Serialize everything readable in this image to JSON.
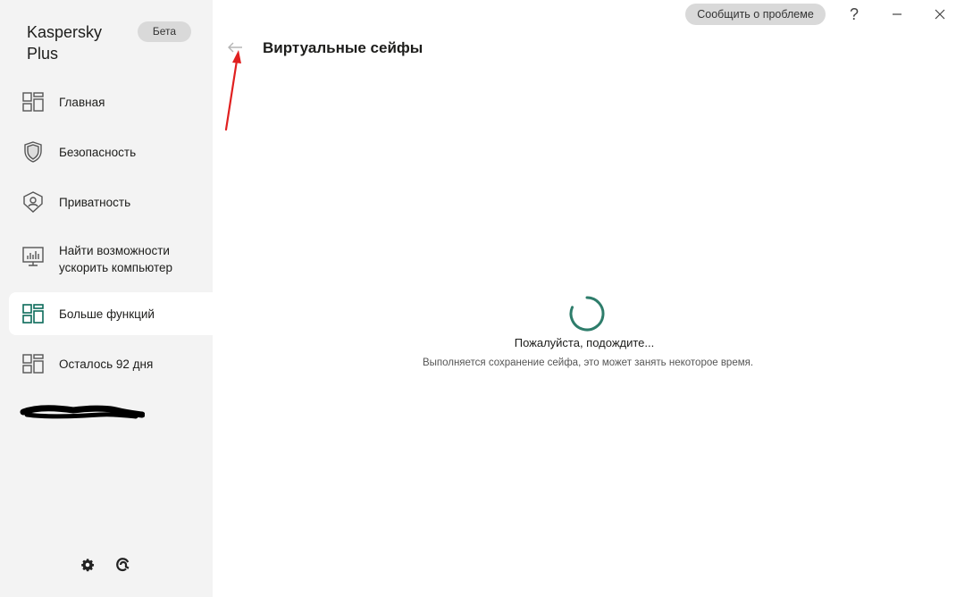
{
  "app": {
    "brand_line1": "Kaspersky",
    "brand_line2": "Plus",
    "badge": "Бета"
  },
  "sidebar": {
    "items": [
      {
        "label": "Главная",
        "icon": "dashboard-icon"
      },
      {
        "label": "Безопасность",
        "icon": "shield-icon"
      },
      {
        "label": "Приватность",
        "icon": "privacy-shield-icon"
      },
      {
        "label_line1": "Найти возможности",
        "label_line2": "ускорить компьютер",
        "icon": "performance-monitor-icon"
      },
      {
        "label": "Больше функций",
        "icon": "more-features-icon",
        "active": true
      },
      {
        "label": "Осталось 92 дня",
        "icon": "license-icon"
      }
    ],
    "bottom": [
      "settings-icon",
      "support-icon"
    ]
  },
  "titlebar": {
    "report_label": "Сообщить о проблеме",
    "help_label": "?"
  },
  "content": {
    "title": "Виртуальные сейфы",
    "wait_text": "Пожалуйста, подождите...",
    "wait_sub": "Выполняется сохранение сейфа, это может занять некоторое время."
  },
  "colors": {
    "accent": "#00a88e",
    "spinner": "#2e7d6b",
    "sidebar_bg": "#f3f3f3",
    "annotation": "#e02020"
  }
}
